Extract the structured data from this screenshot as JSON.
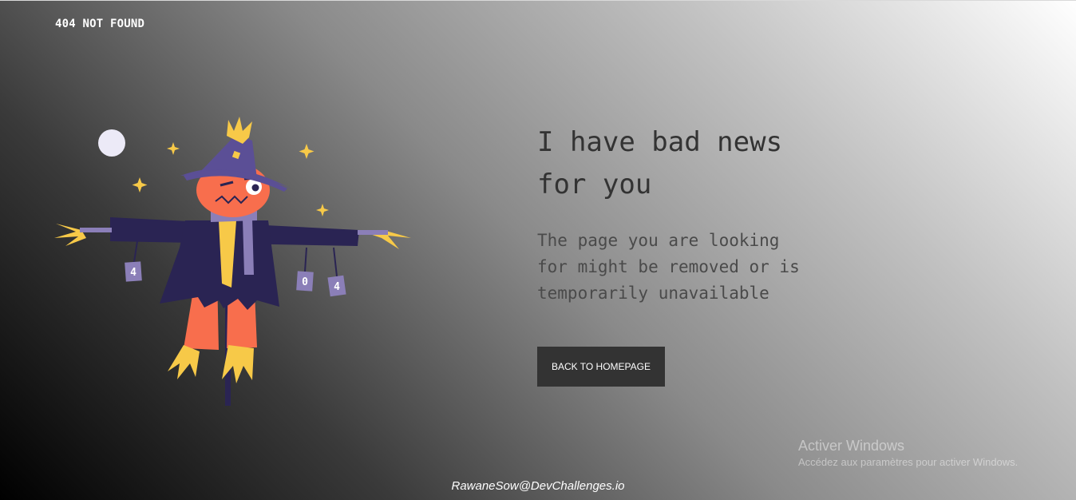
{
  "header": {
    "brand": "404 NOT FOUND"
  },
  "illustration": {
    "cans": [
      "4",
      "0",
      "4"
    ],
    "colors": {
      "hat": "#5b4f96",
      "face": "#f86e4d",
      "coat": "#2a2453",
      "straw": "#f7c948",
      "can": "#8b7fb8",
      "moon": "#eceaf7"
    }
  },
  "main": {
    "headline_line1": "I have bad news",
    "headline_line2": "for you",
    "message_line1": "The page you are looking",
    "message_line2": "for might be removed or is",
    "message_line3": "temporarily unavailable",
    "button_label": "BACK TO HOMEPAGE"
  },
  "watermark": {
    "title": "Activer Windows",
    "subtitle": "Accédez aux paramètres pour activer Windows."
  },
  "footer": {
    "credit": "RawaneSow@DevChallenges.io"
  }
}
